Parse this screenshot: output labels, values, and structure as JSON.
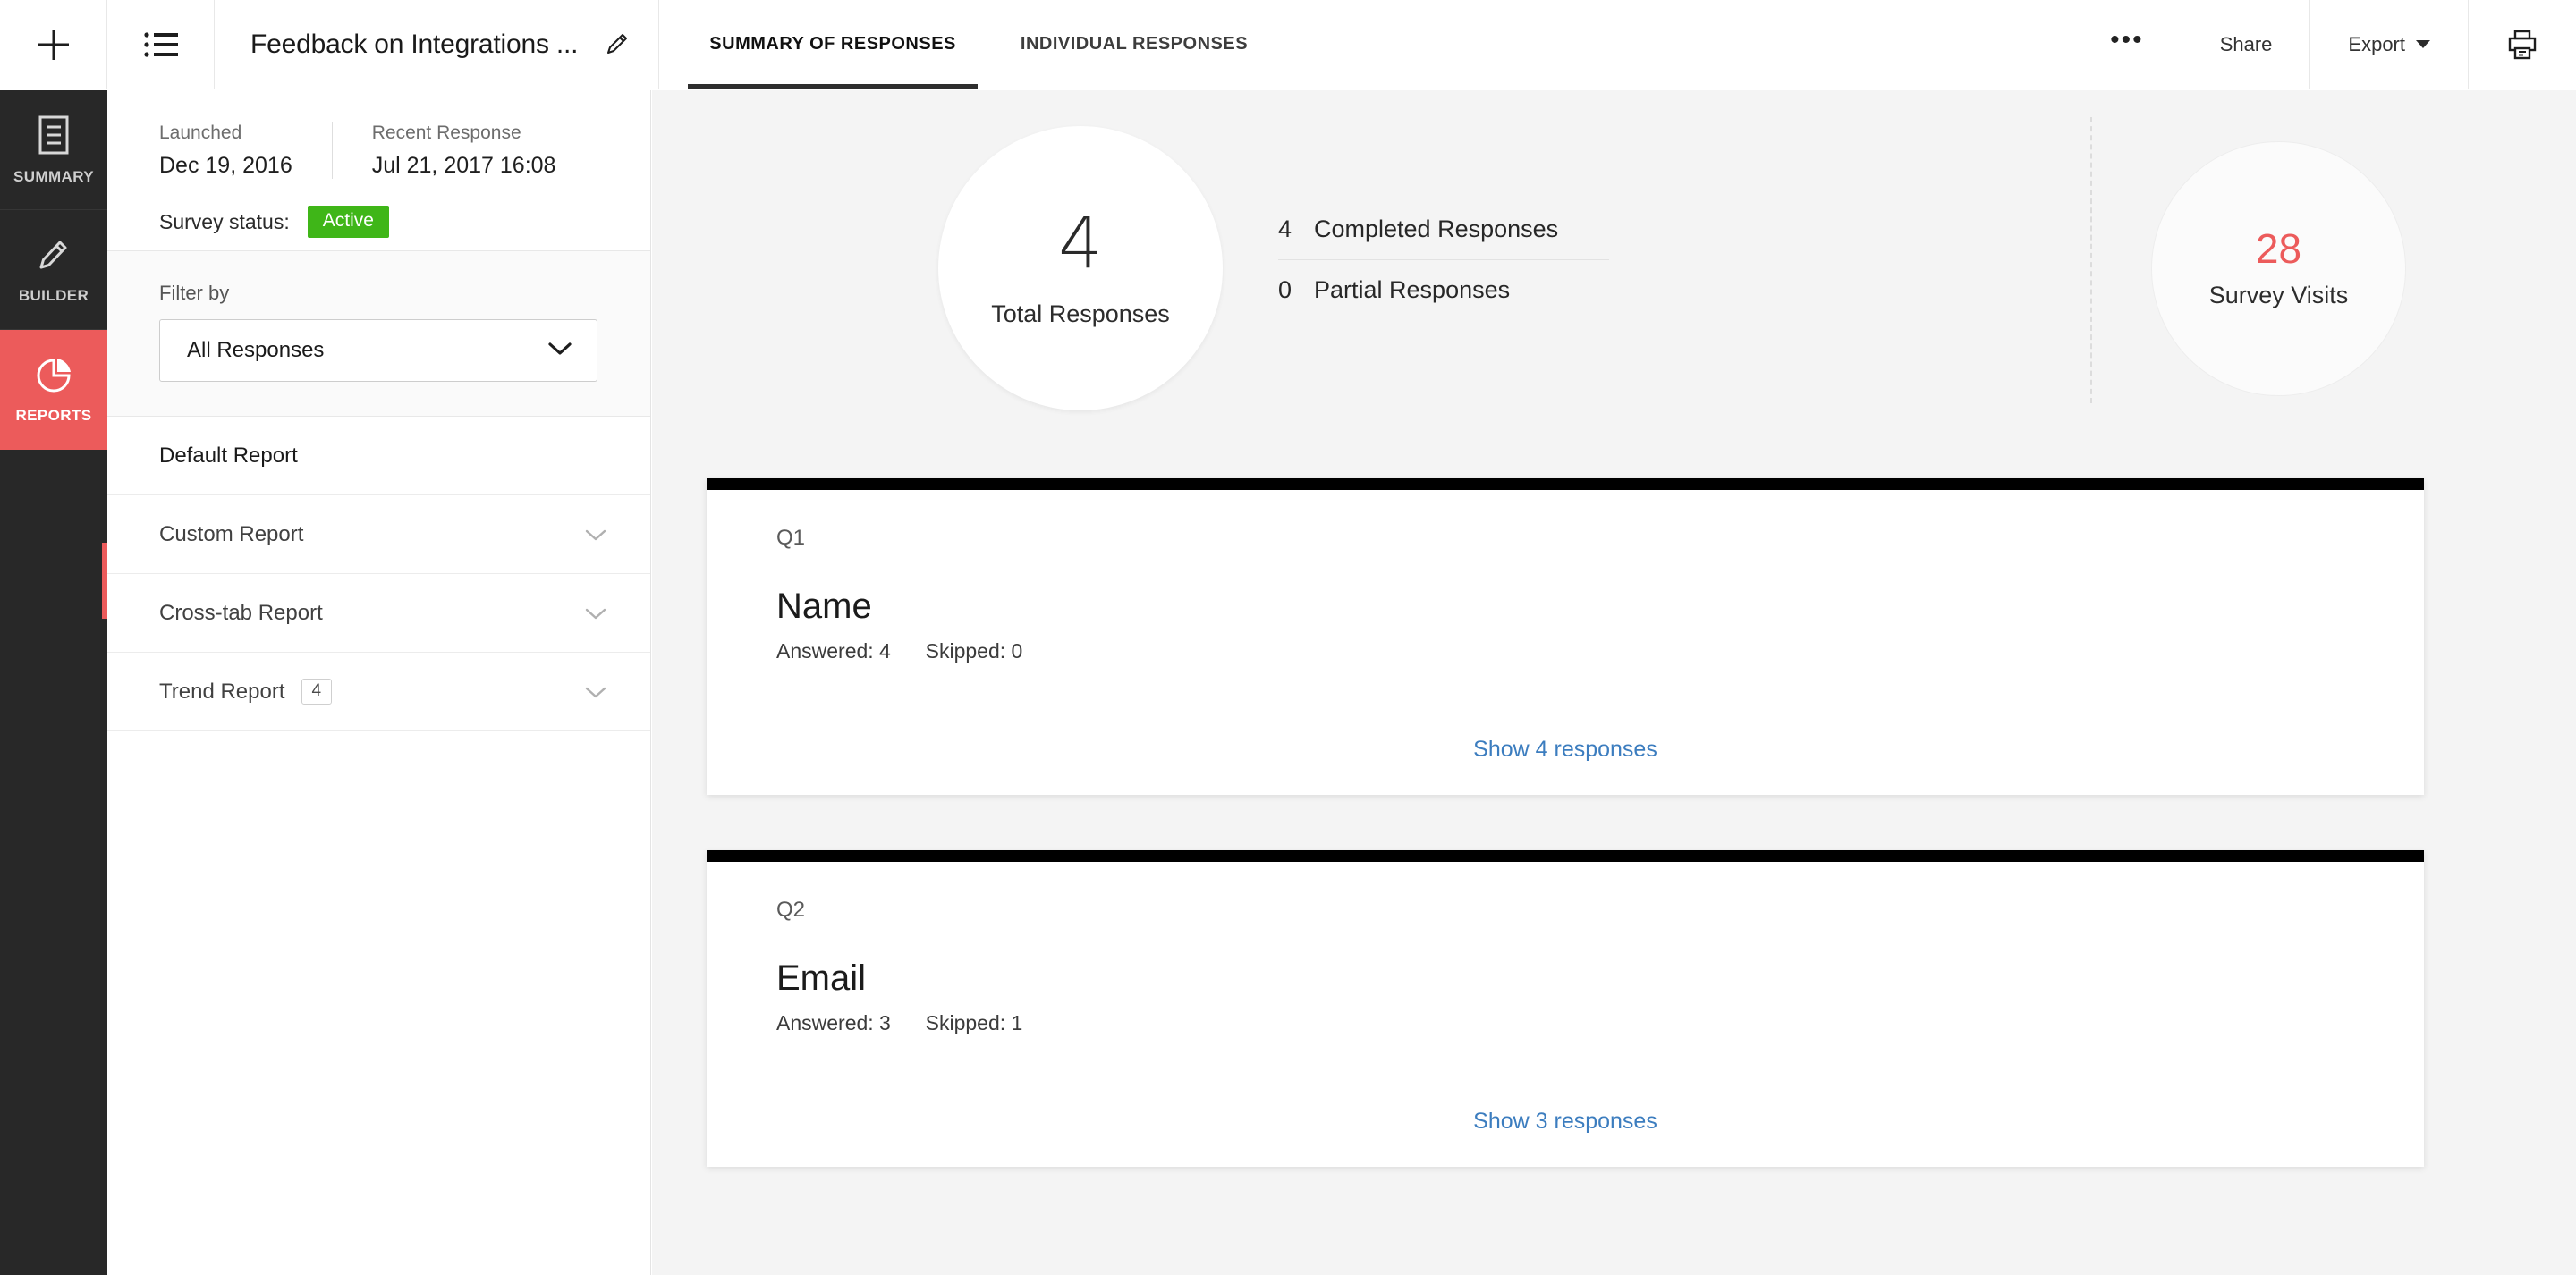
{
  "topbar": {
    "add_icon": "plus-icon",
    "list_icon": "list-icon",
    "survey_title": "Feedback on Integrations ...",
    "edit_icon": "pencil-icon",
    "tabs": [
      {
        "label": "SUMMARY OF RESPONSES",
        "active": true
      },
      {
        "label": "INDIVIDUAL RESPONSES",
        "active": false
      }
    ],
    "more_label": "•••",
    "share_label": "Share",
    "export_label": "Export",
    "print_icon": "printer-icon"
  },
  "rail": {
    "items": [
      {
        "label": "SUMMARY",
        "icon": "document-icon",
        "active": false
      },
      {
        "label": "BUILDER",
        "icon": "pencil-icon",
        "active": false
      },
      {
        "label": "REPORTS",
        "icon": "pie-chart-icon",
        "active": true
      }
    ],
    "active_color": "#ec5b5b"
  },
  "sidebar": {
    "launched_label": "Launched",
    "launched_value": "Dec 19, 2016",
    "recent_label": "Recent Response",
    "recent_value": "Jul 21, 2017 16:08",
    "status_label": "Survey status:",
    "status_value": "Active",
    "status_color": "#3fb618",
    "filter_label": "Filter by",
    "filter_value": "All Responses",
    "reports": [
      {
        "label": "Default Report",
        "active": true,
        "chevron": false,
        "count": null
      },
      {
        "label": "Custom Report",
        "active": false,
        "chevron": true,
        "count": null
      },
      {
        "label": "Cross-tab Report",
        "active": false,
        "chevron": true,
        "count": null
      },
      {
        "label": "Trend Report",
        "active": false,
        "chevron": true,
        "count": "4"
      }
    ]
  },
  "stats": {
    "total_value": "4",
    "total_label": "Total Responses",
    "completed_value": "4",
    "completed_label": "Completed Responses",
    "partial_value": "0",
    "partial_label": "Partial Responses",
    "visits_value": "28",
    "visits_label": "Survey Visits",
    "visits_color": "#ec5b5b"
  },
  "questions": [
    {
      "number": "Q1",
      "title": "Name",
      "answered": "Answered: 4",
      "skipped": "Skipped: 0",
      "link": "Show 4 responses"
    },
    {
      "number": "Q2",
      "title": "Email",
      "answered": "Answered: 3",
      "skipped": "Skipped: 1",
      "link": "Show 3 responses"
    }
  ]
}
